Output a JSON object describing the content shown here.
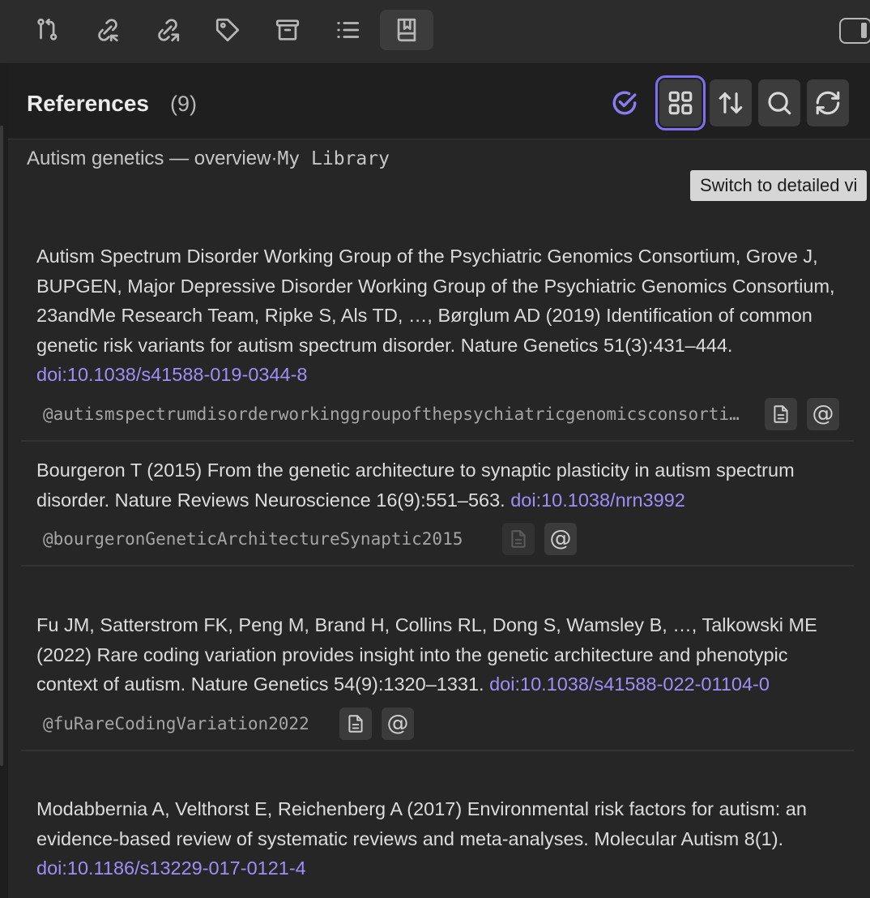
{
  "header": {
    "title": "References",
    "count": "(9)"
  },
  "subtitle": {
    "note": "Autism genetics — overview",
    "separator": "·",
    "library": "My Library"
  },
  "tooltip": "Switch to detailed vi",
  "colors": {
    "accent": "#7e6ef0",
    "doi_link": "#9d8ff5",
    "background": "#262626"
  },
  "icons": {
    "ribbon": [
      "git-compare-icon",
      "link-incoming-icon",
      "link-outgoing-icon",
      "tag-icon",
      "archive-icon",
      "list-icon",
      "bookmark-book-icon"
    ],
    "header": [
      "check-circle-icon",
      "grid-view-icon",
      "sort-icon",
      "search-icon",
      "refresh-icon"
    ],
    "right": "sidebar-toggle-icon",
    "footer": [
      "file-text-icon",
      "at-sign-icon"
    ]
  },
  "references": [
    {
      "text": "Autism Spectrum Disorder Working Group of the Psychiatric Genomics Consortium, Grove J, BUPGEN, Major Depressive Disorder Working Group of the Psychiatric Genomics Consortium, 23andMe Research Team, Ripke S, Als TD, …, Børglum AD (2019) Identification of common genetic risk variants for autism spectrum disorder. Nature Genetics 51(3):431–444.",
      "doi": "doi:10.1038/s41588-019-0344-8",
      "citekey": "@autismspectrumdisorderworkinggroupofthepsychiatricgenomicsconsortium"
    },
    {
      "text": "Bourgeron T (2015) From the genetic architecture to synaptic plasticity in autism spectrum disorder. Nature Reviews Neuroscience 16(9):551–563.",
      "doi": "doi:10.1038/nrn3992",
      "citekey": "@bourgeronGeneticArchitectureSynaptic2015"
    },
    {
      "text": "Fu JM, Satterstrom FK, Peng M, Brand H, Collins RL, Dong S, Wamsley B, …, Talkowski ME (2022) Rare coding variation provides insight into the genetic architecture and phenotypic context of autism. Nature Genetics 54(9):1320–1331.",
      "doi": "doi:10.1038/s41588-022-01104-0",
      "citekey": "@fuRareCodingVariation2022"
    },
    {
      "text": "Modabbernia A, Velthorst E, Reichenberg A (2017) Environmental risk factors for autism: an evidence-based review of systematic reviews and meta-analyses. Molecular Autism 8(1).",
      "doi": "doi:10.1186/s13229-017-0121-4",
      "citekey": ""
    }
  ]
}
